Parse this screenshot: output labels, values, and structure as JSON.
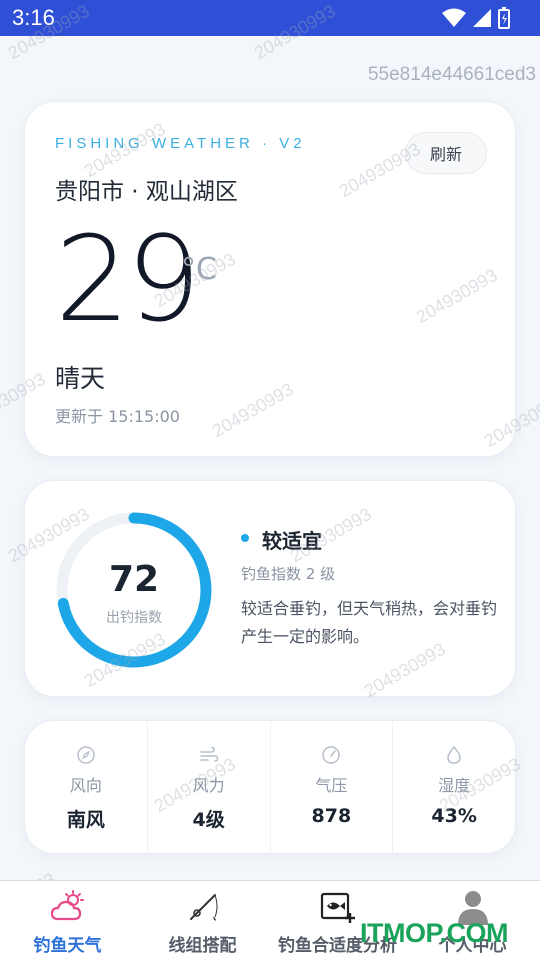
{
  "status_bar": {
    "time": "3:16"
  },
  "id_text": "55e814e44661ced3",
  "weather": {
    "eyebrow": "FISHING WEATHER · V2",
    "refresh_label": "刷新",
    "location": "贵阳市 · 观山湖区",
    "temperature": "29",
    "unit": "°C",
    "condition": "晴天",
    "updated": "更新于 15:15:00"
  },
  "index": {
    "value": "72",
    "value_number": 72,
    "max": 100,
    "label": "出钓指数",
    "level": "较适宜",
    "level_sub": "钓鱼指数 2 级",
    "description": "较适合垂钓，但天气稍热，会对垂钓产生一定的影响。",
    "accent_color": "#1ea7e8"
  },
  "stats": [
    {
      "icon": "compass-icon",
      "label": "风向",
      "value": "南风"
    },
    {
      "icon": "wind-icon",
      "label": "风力",
      "value": "4级"
    },
    {
      "icon": "gauge-icon",
      "label": "气压",
      "value": "878"
    },
    {
      "icon": "droplet-icon",
      "label": "湿度",
      "value": "43%"
    }
  ],
  "nav": [
    {
      "icon": "weather-cloud-icon",
      "label": "钓鱼天气",
      "active": true
    },
    {
      "icon": "fishing-rod-icon",
      "label": "线组搭配",
      "active": false
    },
    {
      "icon": "fish-analysis-icon",
      "label": "钓鱼合适度分析",
      "active": false
    },
    {
      "icon": "user-icon",
      "label": "个人中心",
      "active": false
    }
  ],
  "watermark": "204930993",
  "brand_watermark": "ITMOP.COM",
  "colors": {
    "status_bar": "#2f4fd7",
    "accent": "#3bb0e3",
    "active_nav": "#2f73d9"
  }
}
